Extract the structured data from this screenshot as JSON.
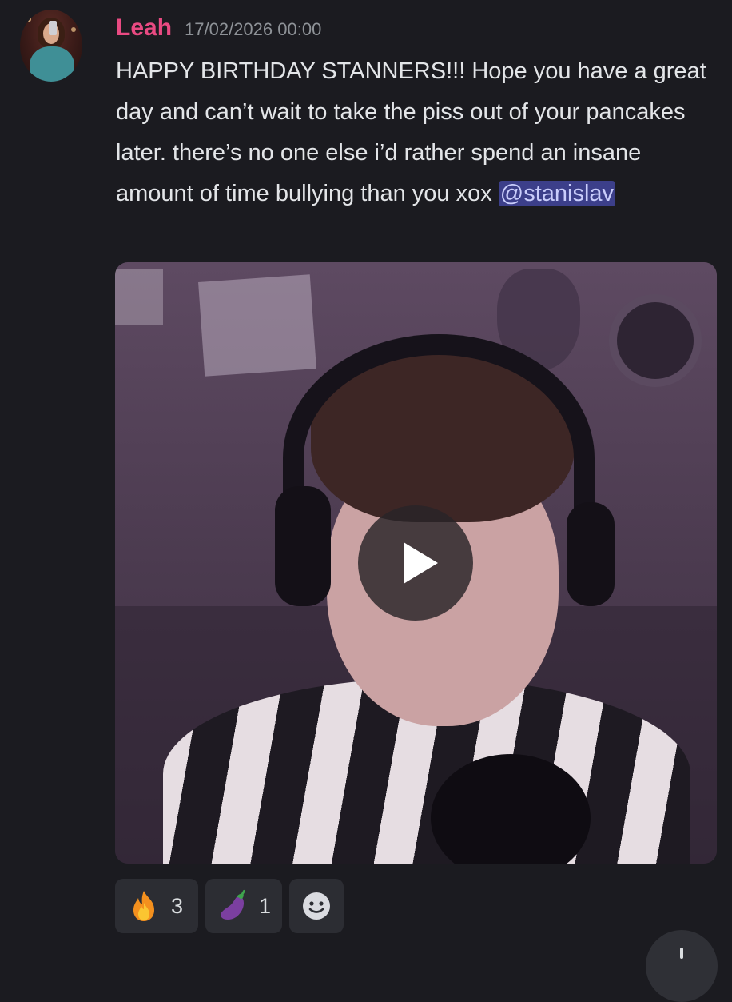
{
  "message": {
    "author": "Leah",
    "timestamp": "17/02/2026 00:00",
    "text": "HAPPY BIRTHDAY STANNERS!!! Hope you have a great day and can’t wait to take the piss out of your pancakes later. there’s no one else i’d rather spend an insane amount of time bullying than you xox ",
    "mention": "@stanislav",
    "author_color": "#e94a82"
  },
  "attachment": {
    "type": "video",
    "play_icon": "play-icon"
  },
  "reactions": [
    {
      "emoji": "fire-emoji",
      "count": "3"
    },
    {
      "emoji": "eggplant-emoji",
      "count": "1"
    },
    {
      "emoji": "add-reaction-icon"
    }
  ],
  "colors": {
    "background": "#1b1b20",
    "mention_bg": "#3c3f8a",
    "mention_text": "#c9cdfb",
    "reaction_bg": "#2c2d33"
  }
}
